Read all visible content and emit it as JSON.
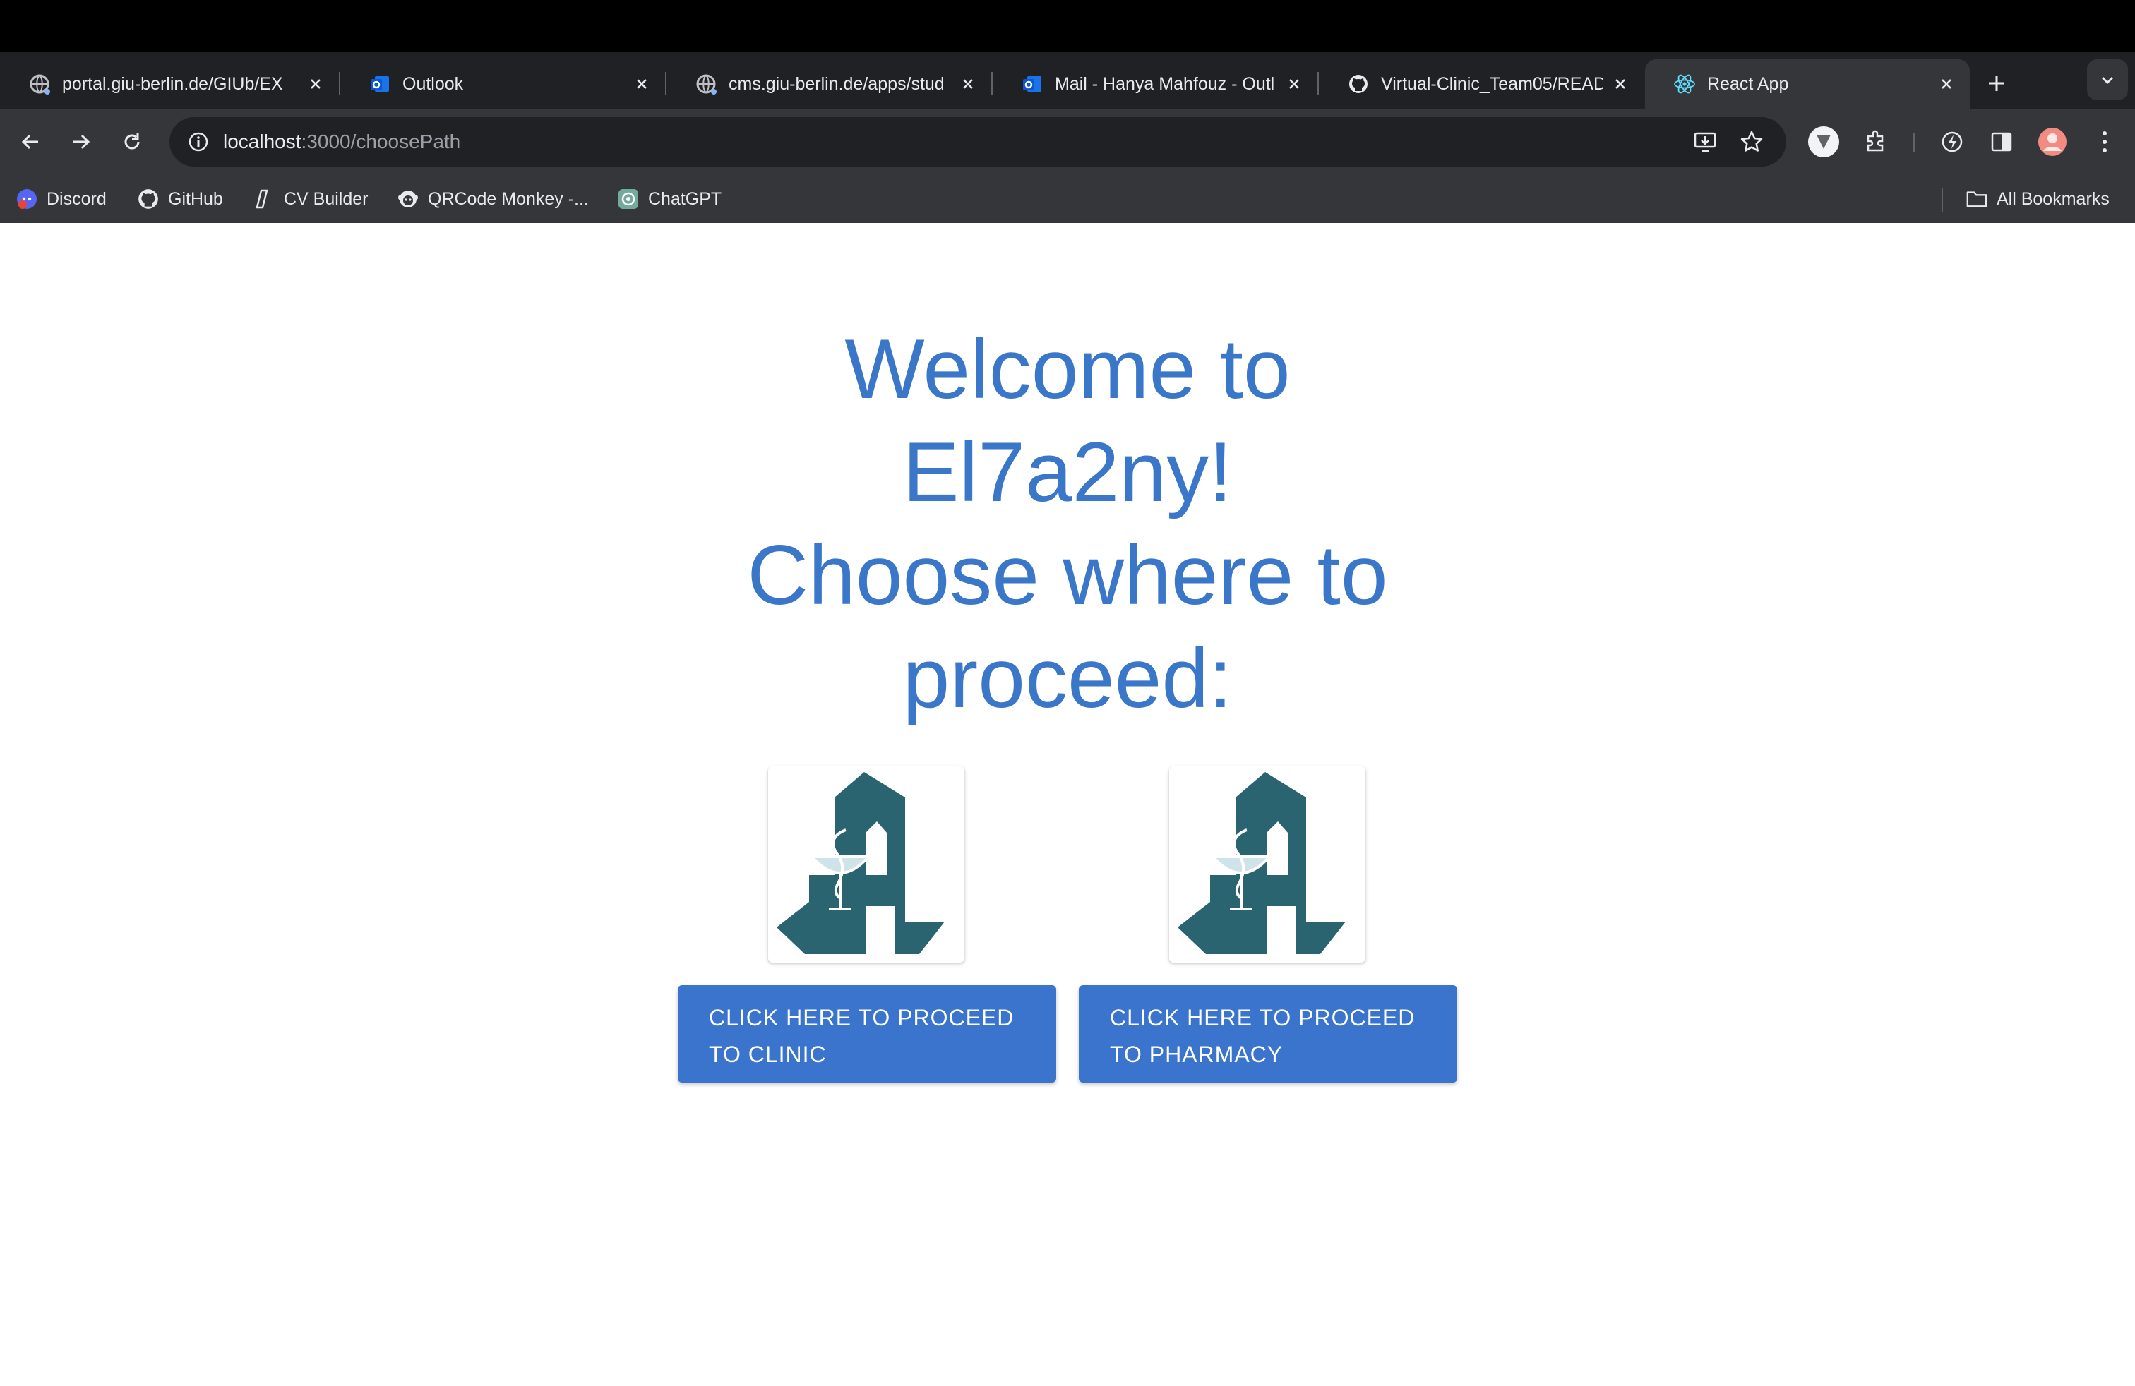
{
  "browser": {
    "tabs": [
      {
        "title": "portal.giu-berlin.de/GIUb/EX",
        "icon": "globe-icon"
      },
      {
        "title": "Outlook",
        "icon": "outlook-icon"
      },
      {
        "title": "cms.giu-berlin.de/apps/stud",
        "icon": "globe-icon"
      },
      {
        "title": "Mail - Hanya Mahfouz - Outl",
        "icon": "outlook-icon"
      },
      {
        "title": "Virtual-Clinic_Team05/READ",
        "icon": "github-icon"
      },
      {
        "title": "React App",
        "icon": "react-icon",
        "active": true
      }
    ],
    "address": {
      "host": "localhost",
      "path": ":3000/choosePath"
    },
    "bookmarks": [
      {
        "label": "Discord",
        "icon": "discord-icon"
      },
      {
        "label": "GitHub",
        "icon": "github-icon"
      },
      {
        "label": "CV Builder",
        "icon": "cv-icon"
      },
      {
        "label": "QRCode Monkey -...",
        "icon": "monkey-icon"
      },
      {
        "label": "ChatGPT",
        "icon": "chatgpt-icon"
      }
    ],
    "all_bookmarks": "All Bookmarks"
  },
  "page": {
    "heading_line1": "Welcome to",
    "heading_line2": "El7a2ny!",
    "heading_line3": "Choose where to",
    "heading_line4": "proceed:",
    "clinic_button_line1": "CLICK HERE TO PROCEED",
    "clinic_button_line2": "TO CLINIC",
    "pharmacy_button_line1": "CLICK HERE TO PROCEED",
    "pharmacy_button_line2": "TO PHARMACY",
    "logo_color": "#2a6470",
    "accent_color": "#3a74cc"
  }
}
